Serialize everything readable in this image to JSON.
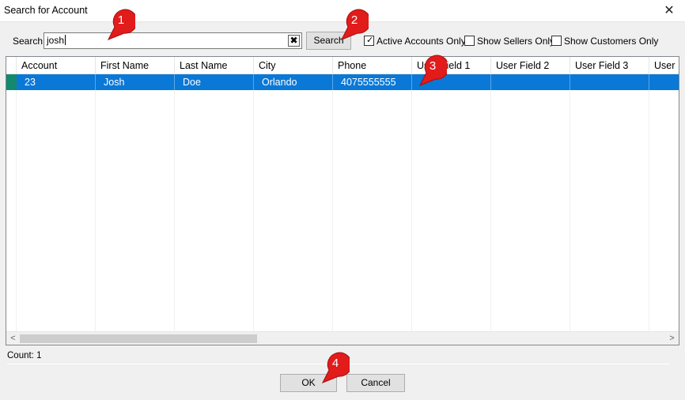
{
  "window": {
    "title": "Search for Account",
    "close_glyph": "✕"
  },
  "search": {
    "label": "Search",
    "value": "josh",
    "clear_glyph": "✖",
    "button_label": "Search"
  },
  "filters": {
    "active_accounts_only": {
      "label": "Active Accounts Only",
      "checked": true,
      "mark": "✓"
    },
    "show_sellers_only": {
      "label": "Show Sellers Only",
      "checked": false
    },
    "show_customers_only": {
      "label": "Show Customers Only",
      "checked": false
    }
  },
  "grid": {
    "columns": [
      "Account",
      "First Name",
      "Last Name",
      "City",
      "Phone",
      "User Field 1",
      "User Field 2",
      "User Field 3",
      "User"
    ],
    "rows": [
      {
        "account": "23",
        "first_name": "Josh",
        "last_name": "Doe",
        "city": "Orlando",
        "phone": "4075555555",
        "user_field_1": "",
        "user_field_2": "",
        "user_field_3": "",
        "user": ""
      }
    ],
    "scroll_left_glyph": "<",
    "scroll_right_glyph": ">"
  },
  "status": {
    "count": "Count: 1"
  },
  "footer": {
    "ok_label": "OK",
    "cancel_label": "Cancel"
  },
  "callouts": [
    "1",
    "2",
    "3",
    "4"
  ],
  "colors": {
    "selection": "#0a78d7",
    "row_indicator": "#138a6f",
    "callout": "#e21b1b"
  }
}
